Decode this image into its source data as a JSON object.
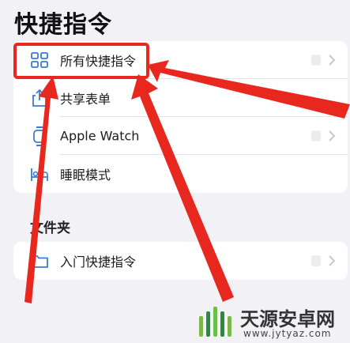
{
  "page": {
    "title": "快捷指令"
  },
  "list": {
    "items": [
      {
        "label": "所有快捷指令",
        "icon": "grid-icon"
      },
      {
        "label": "共享表单",
        "icon": "share-icon"
      },
      {
        "label": "Apple Watch",
        "icon": "watch-icon"
      },
      {
        "label": "睡眠模式",
        "icon": "bed-icon"
      }
    ]
  },
  "folders": {
    "header": "文件夹",
    "items": [
      {
        "label": "入门快捷指令",
        "icon": "folder-icon"
      }
    ]
  },
  "colors": {
    "accent": "#3a7bd5",
    "annotation": "#e8281e",
    "background": "#f2f2f6"
  },
  "watermark": {
    "text": "天源安卓网",
    "url": "www.jytyaz.com"
  }
}
